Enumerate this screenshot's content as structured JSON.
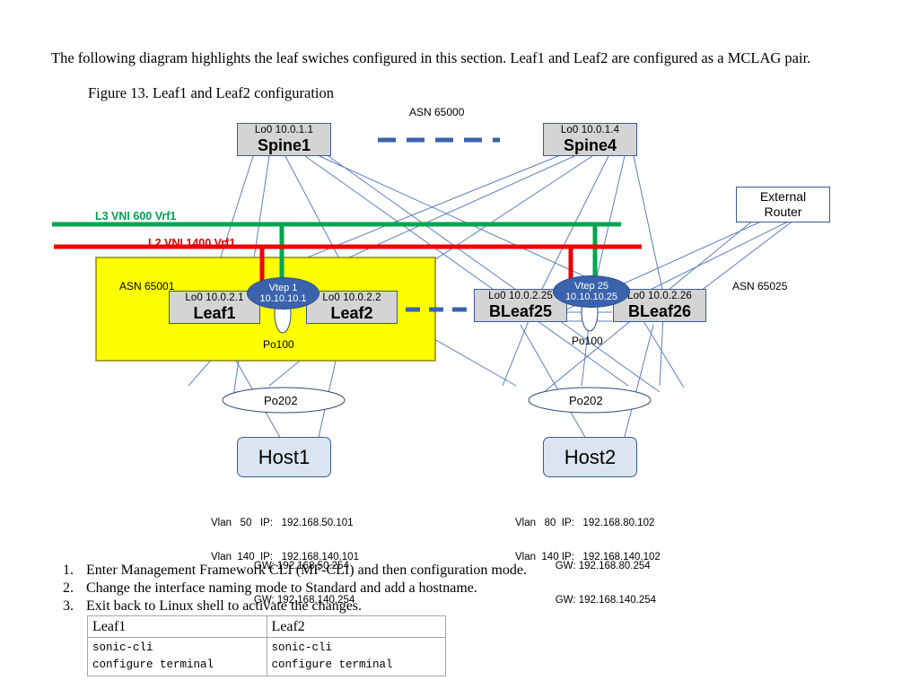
{
  "document": {
    "intro_paragraph": "The following diagram highlights the leaf swiches configured in this section. Leaf1 and Leaf2 are configured as a MCLAG pair.",
    "figure_caption": "Figure 13. Leaf1 and Leaf2 configuration"
  },
  "diagram": {
    "asn_spine": "ASN 65000",
    "asn_leaf_pod": "ASN 65001",
    "asn_bleaf_pod": "ASN 65025",
    "vni_l3": "L3 VNI 600 Vrf1",
    "vni_l2": "L2 VNI 1400 Vrf1",
    "colors": {
      "l3_vni_line": "#00a64f",
      "l2_vni_line": "#ee0000",
      "pod_highlight": "#ffff00",
      "switch_fill": "#d4d4d4",
      "host_fill": "#dbe5f1",
      "vtep_fill": "#3a63ad",
      "link_line": "#5b7fbd",
      "dashed_link": "#3a63ad"
    },
    "spines": [
      {
        "loopback": "Lo0  10.0.1.1",
        "name": "Spine1"
      },
      {
        "loopback": "Lo0 10.0.1.4",
        "name": "Spine4"
      }
    ],
    "external_router": {
      "line1": "External",
      "line2": "Router"
    },
    "leaves": [
      {
        "loopback": "Lo0 10.0.2.1",
        "name": "Leaf1"
      },
      {
        "loopback": "Lo0 10.0.2.2",
        "name": "Leaf2"
      },
      {
        "loopback": "Lo0 10.0.2.25",
        "name": "BLeaf25"
      },
      {
        "loopback": "Lo0 10.0.2.26",
        "name": "BLeaf26"
      }
    ],
    "vteps": [
      {
        "name": "Vtep 1",
        "ip": "10.10.10.1"
      },
      {
        "name": "Vtep 25",
        "ip": "10.10.10.25"
      }
    ],
    "po100_left": "Po100",
    "po100_right": "Po100",
    "po202_left": "Po202",
    "po202_right": "Po202",
    "hosts": [
      {
        "name": "Host1"
      },
      {
        "name": "Host2"
      }
    ],
    "host1_vlans": [
      {
        "line1": "Vlan   50   IP:   192.168.50.101",
        "line2": "               GW: 192.168.50.254"
      },
      {
        "line1": "Vlan  140  IP:   192.168.140.101",
        "line2": "               GW: 192.168.140.254"
      }
    ],
    "host2_vlans": [
      {
        "line1": "Vlan   80  IP:   192.168.80.102",
        "line2": "              GW: 192.168.80.254"
      },
      {
        "line1": "Vlan  140 IP:   192.168.140.102",
        "line2": "              GW: 192.168.140.254"
      }
    ]
  },
  "steps": [
    {
      "num": "1.",
      "text": "Enter Management Framework CLI (MF-CLI) and then configuration mode."
    },
    {
      "num": "2.",
      "text": "Change the interface naming mode to Standard and add a hostname."
    },
    {
      "num": "3.",
      "text": "Exit back to Linux shell to activate the changes."
    }
  ],
  "config_table": {
    "headers": [
      "Leaf1",
      "Leaf2"
    ],
    "rows": [
      [
        "sonic-cli\nconfigure terminal",
        "sonic-cli\nconfigure terminal"
      ]
    ]
  }
}
